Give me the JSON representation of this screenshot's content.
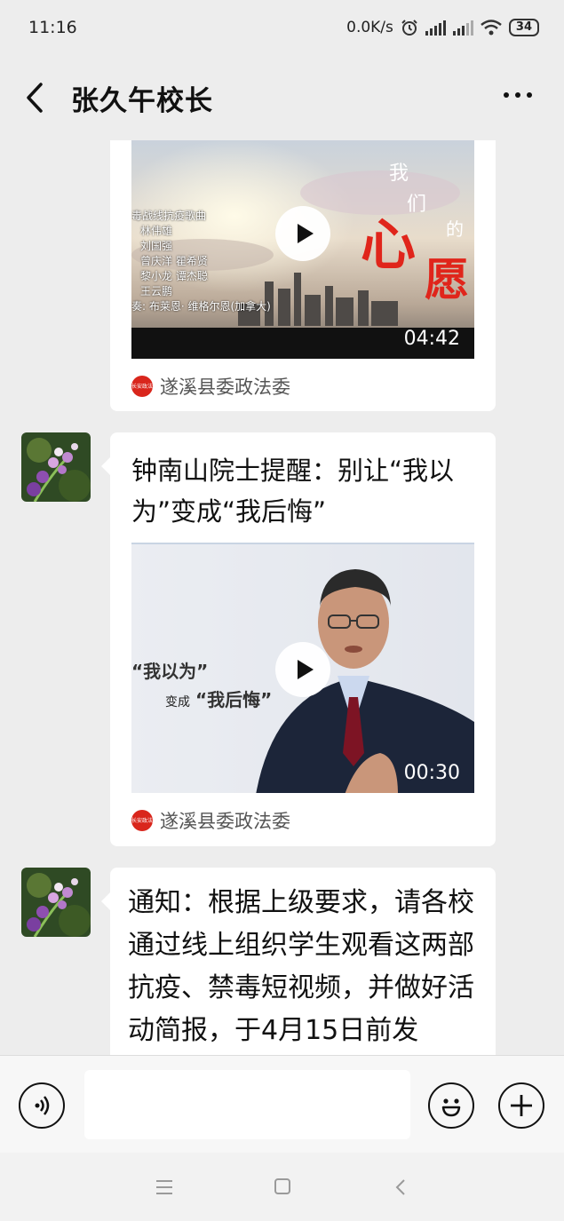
{
  "status": {
    "time": "11:16",
    "speed": "0.0K/s",
    "battery": "34"
  },
  "header": {
    "title": "张久午校长"
  },
  "messages": [
    {
      "type": "video-card",
      "video": {
        "duration": "04:42",
        "overlay_credits": [
          "毒战线抗疫歌曲",
          "林伟雄",
          "刘国强",
          "曾庆洋 瞿希贤",
          "黎小龙 谭杰聪",
          "王云鹏",
          "奏: 布莱恩· 维格尔恩(加拿大)"
        ],
        "overlay_title": [
          "我",
          "们",
          "的",
          "心",
          "愿"
        ]
      },
      "source": {
        "icon_text": "长安政法",
        "name": "遂溪县委政法委"
      }
    },
    {
      "type": "video-card",
      "title": "钟南山院士提醒：别让“我以为”变成“我后悔”",
      "video": {
        "duration": "00:30",
        "overlay_line1": "“我以为”",
        "overlay_line2_prefix": "变成",
        "overlay_line2": "“我后悔”"
      },
      "source": {
        "icon_text": "长安政法",
        "name": "遂溪县委政法委"
      }
    },
    {
      "type": "text",
      "text": "通知：根据上级要求，请各校通过线上组织学生观看这两部抗疫、禁毒短视频，并做好活动简报，于4月15日前发"
    }
  ],
  "colors": {
    "background": "#ededed",
    "bubble": "#ffffff",
    "source_icon": "#d9261c"
  },
  "icons": [
    "back-icon",
    "more-icon",
    "voice-icon",
    "emoji-icon",
    "add-icon"
  ]
}
